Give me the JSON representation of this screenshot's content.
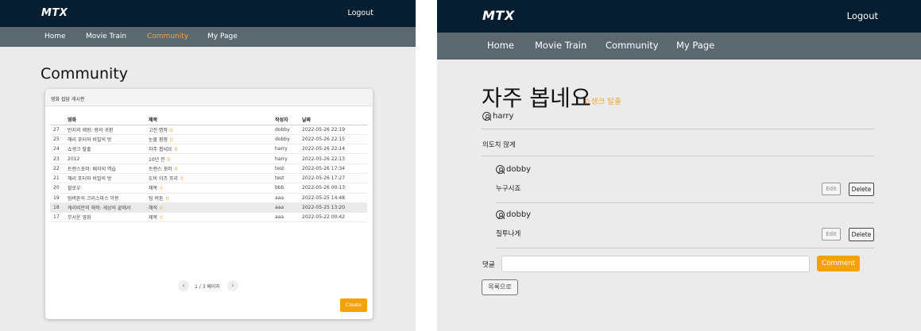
{
  "left": {
    "app": {
      "logo": "MTX",
      "logout_label": "Logout"
    },
    "nav": [
      {
        "label": "Home"
      },
      {
        "label": "Movie Train"
      },
      {
        "label": "Community"
      },
      {
        "label": "My Page"
      }
    ],
    "page_title": "Community",
    "board": {
      "header": "영화 잡담 게시판",
      "columns": [
        "영화",
        "제목",
        "작성자",
        "날짜"
      ],
      "rows": [
        {
          "no": "27",
          "movie": "반지의 제왕: 왕의 귀환",
          "title": "고전 명작",
          "comments": "0",
          "author": "dobby",
          "date": "2022-05-26 22:19"
        },
        {
          "no": "25",
          "movie": "해리 포터와 비밀의 방",
          "title": "눈물 펑펑",
          "comments": "0",
          "author": "dobby",
          "date": "2022-05-26 22:15"
        },
        {
          "no": "24",
          "movie": "쇼생크 탈출",
          "title": "자주 봅네요",
          "comments": "0",
          "author": "harry",
          "date": "2022-05-26 22:14"
        },
        {
          "no": "23",
          "movie": "2012",
          "title": "10년 전",
          "comments": "0",
          "author": "harry",
          "date": "2022-05-26 22:13"
        },
        {
          "no": "22",
          "movie": "트랜스포머: 패자의 역습",
          "title": "트랜스 포머",
          "comments": "0",
          "author": "test",
          "date": "2022-05-26 17:34"
        },
        {
          "no": "21",
          "movie": "해리 포터와 비밀의 방",
          "title": "도비 이즈 프리",
          "comments": "0",
          "author": "test",
          "date": "2022-05-26 17:27"
        },
        {
          "no": "20",
          "movie": "할로우",
          "title": "제목",
          "comments": "0",
          "author": "bbb",
          "date": "2022-05-26 00:13"
        },
        {
          "no": "19",
          "movie": "팀버튼의 크리스마스 악몽",
          "title": "팀 버튼",
          "comments": "0",
          "author": "aaa",
          "date": "2022-05-25 14:48"
        },
        {
          "no": "18",
          "movie": "캐리비안의 해적: 세상의 끝에서",
          "title": "해적",
          "comments": "0",
          "author": "aaa",
          "date": "2022-05-25 13:20"
        },
        {
          "no": "17",
          "movie": "무서운 영화",
          "title": "제목",
          "comments": "0",
          "author": "aaa",
          "date": "2022-05-22 00:42"
        }
      ],
      "pagination": "1 / 3 페이지",
      "create_label": "Create"
    }
  },
  "right": {
    "app": {
      "logo": "MTX",
      "logout_label": "Logout"
    },
    "nav": [
      {
        "label": "Home"
      },
      {
        "label": "Movie Train"
      },
      {
        "label": "Community"
      },
      {
        "label": "My Page"
      }
    ],
    "post": {
      "title": "자주 봅네요",
      "movie": "쇼생크 탈출",
      "author": "harry",
      "content": "의도치 않게"
    },
    "comments": [
      {
        "author": "dobby",
        "text": "누구시죠",
        "edit_label": "Edit",
        "delete_label": "Delete"
      },
      {
        "author": "dobby",
        "text": "질투나게",
        "edit_label": "Edit",
        "delete_label": "Delete"
      }
    ],
    "comment_form": {
      "label": "댓글",
      "value": "",
      "placeholder": "",
      "submit_label": "Comment"
    },
    "back_label": "목록으로"
  },
  "colors": {
    "navy": "#071e30",
    "nav_gray": "#5b6870",
    "accent": "#f5a10a",
    "background": "#ebebeb"
  }
}
